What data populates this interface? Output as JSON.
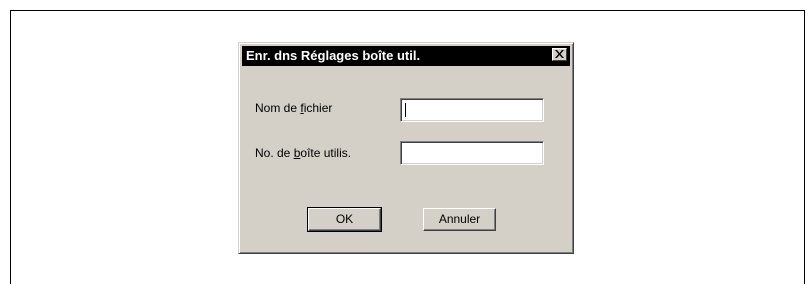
{
  "dialog": {
    "title": "Enr. dns Réglages boîte util.",
    "close_icon": "close-icon"
  },
  "form": {
    "filename_label_pre": "Nom de ",
    "filename_label_acc": "f",
    "filename_label_post": "ichier",
    "filename_value": "",
    "box_label_pre": "No. de ",
    "box_label_acc": "b",
    "box_label_post": "oîte utilis.",
    "box_value": ""
  },
  "buttons": {
    "ok_label": "OK",
    "cancel_label": "Annuler"
  }
}
